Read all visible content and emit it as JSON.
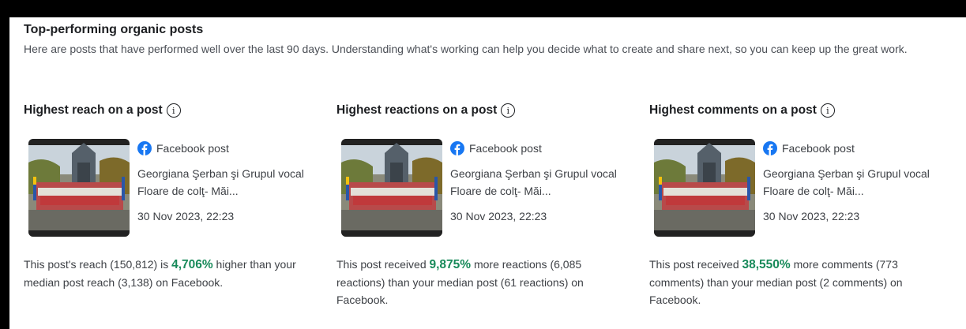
{
  "section": {
    "title": "Top-performing organic posts",
    "description": "Here are posts that have performed well over the last 90 days. Understanding what's working can help you decide what to create and share next, so you can keep up the great work."
  },
  "colors": {
    "accent_green": "#188a5a",
    "facebook_blue": "#1877f2"
  },
  "cards": [
    {
      "heading": "Highest reach on a post",
      "post_type": "Facebook post",
      "post_title": "Georgiana Şerban şi Grupul vocal Floare de colţ- Măi...",
      "post_date": "30 Nov 2023, 22:23",
      "summary_before": "This post's reach (150,812) is ",
      "summary_pct": "4,706%",
      "summary_after": " higher than your median post reach (3,138) on Facebook."
    },
    {
      "heading": "Highest reactions on a post",
      "post_type": "Facebook post",
      "post_title": "Georgiana Şerban şi Grupul vocal Floare de colţ- Măi...",
      "post_date": "30 Nov 2023, 22:23",
      "summary_before": "This post received ",
      "summary_pct": "9,875%",
      "summary_after": " more reactions (6,085 reactions) than your median post (61 reactions) on Facebook."
    },
    {
      "heading": "Highest comments on a post",
      "post_type": "Facebook post",
      "post_title": "Georgiana Şerban şi Grupul vocal Floare de colţ- Măi...",
      "post_date": "30 Nov 2023, 22:23",
      "summary_before": "This post received ",
      "summary_pct": "38,550%",
      "summary_after": " more comments (773 comments) than your median post (2 comments) on Facebook."
    }
  ],
  "icons": {
    "info": "info-icon",
    "facebook": "facebook-icon"
  }
}
